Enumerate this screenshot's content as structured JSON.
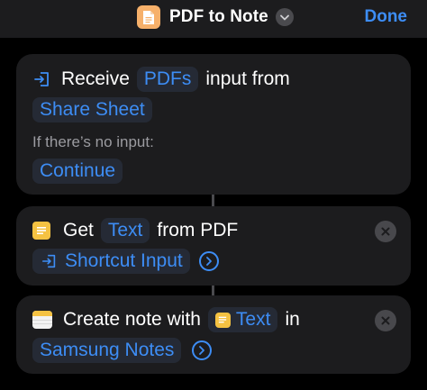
{
  "header": {
    "title": "PDF to Note",
    "done_label": "Done"
  },
  "action_receive": {
    "verb": "Receive",
    "type_token": "PDFs",
    "connector": "input from",
    "source_token": "Share Sheet",
    "no_input_label": "If there’s no input:",
    "fallback_token": "Continue"
  },
  "action_get_text": {
    "verb": "Get",
    "text_token": "Text",
    "connector": "from PDF",
    "input_token": "Shortcut Input"
  },
  "action_create_note": {
    "verb": "Create note with",
    "content_token": "Text",
    "connector": "in",
    "app_token": "Samsung Notes"
  },
  "colors": {
    "accent": "#3d8df5",
    "card_bg": "#1c1c1e",
    "token_bg": "#252a35",
    "app_icon": "#f6b06a",
    "text_icon": "#f5c242"
  }
}
